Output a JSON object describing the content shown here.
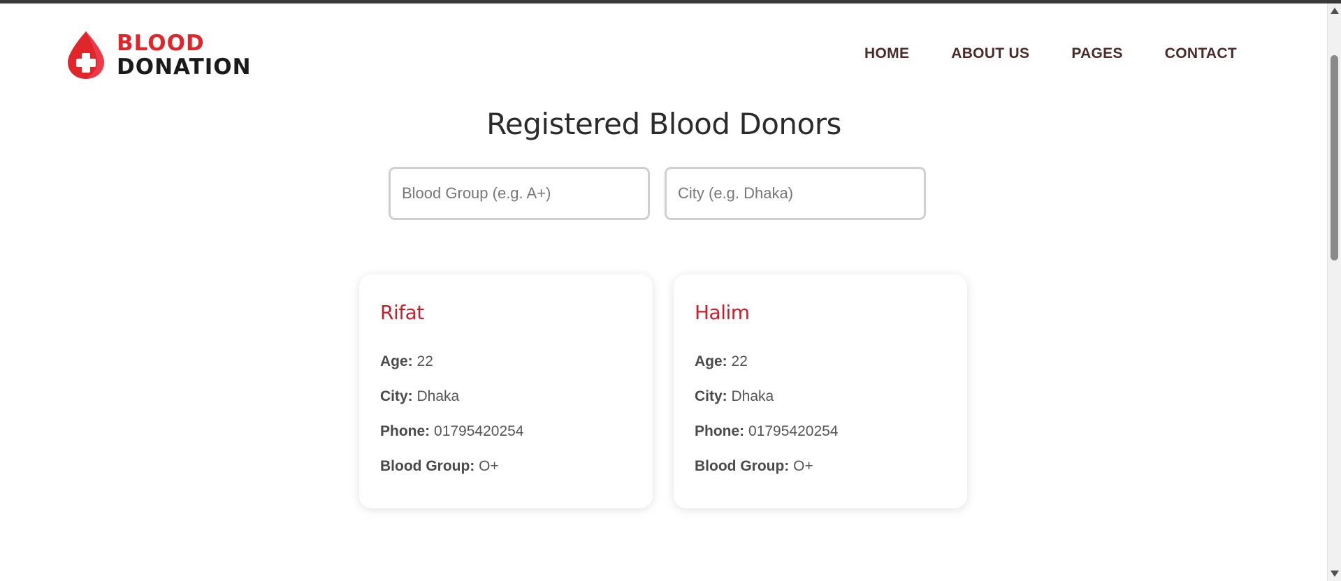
{
  "header": {
    "logo": {
      "line1": "BLOOD",
      "line2": "DONATION"
    },
    "nav": [
      {
        "label": "HOME"
      },
      {
        "label": "ABOUT US"
      },
      {
        "label": "PAGES"
      },
      {
        "label": "CONTACT"
      }
    ]
  },
  "page_title": "Registered Blood Donors",
  "filters": {
    "blood_group_placeholder": "Blood Group (e.g. A+)",
    "blood_group_value": "",
    "city_placeholder": "City (e.g. Dhaka)",
    "city_value": ""
  },
  "labels": {
    "age": "Age:",
    "city": "City:",
    "phone": "Phone:",
    "blood_group": "Blood Group:"
  },
  "donors": [
    {
      "name": "Rifat",
      "age": "22",
      "city": "Dhaka",
      "phone": "01795420254",
      "blood_group": "O+"
    },
    {
      "name": "Halim",
      "age": "22",
      "city": "Dhaka",
      "phone": "01795420254",
      "blood_group": "O+"
    }
  ],
  "colors": {
    "brand_red": "#e0262b",
    "donor_name": "#c81e2a",
    "nav_text": "#4a2a2a"
  },
  "icons": {
    "logo": "blood-drop-cross-icon"
  }
}
